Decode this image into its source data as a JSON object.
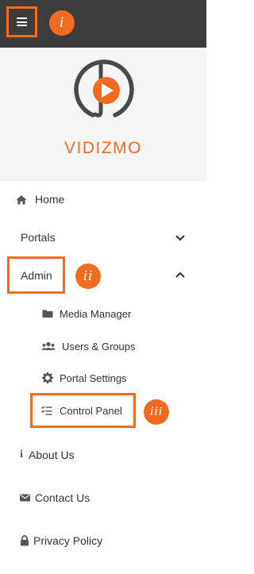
{
  "callouts": {
    "menu": "i",
    "admin": "ii",
    "control_panel": "iii"
  },
  "brand": {
    "name": "VIDIZMO",
    "color": "#f26b21"
  },
  "nav": {
    "home": "Home",
    "portals": "Portals",
    "admin": "Admin",
    "admin_children": {
      "media_manager": "Media Manager",
      "users_groups": "Users & Groups",
      "portal_settings": "Portal Settings",
      "control_panel": "Control Panel"
    },
    "about": "About Us",
    "contact": "Contact Us",
    "privacy": "Privacy Policy"
  },
  "icons": {
    "menu": "hamburger-icon",
    "home": "home-icon",
    "portals_toggle": "chevron-down-icon",
    "admin_toggle": "chevron-up-icon",
    "media_manager": "folder-icon",
    "users_groups": "users-icon",
    "portal_settings": "gear-icon",
    "control_panel": "checklist-icon",
    "about": "info-icon",
    "contact": "envelope-icon",
    "privacy": "lock-icon"
  },
  "colors": {
    "accent": "#f26b21",
    "topbar": "#3c3c3c",
    "header_bg": "#f5f5f5",
    "text": "#333333",
    "icon": "#555555"
  }
}
